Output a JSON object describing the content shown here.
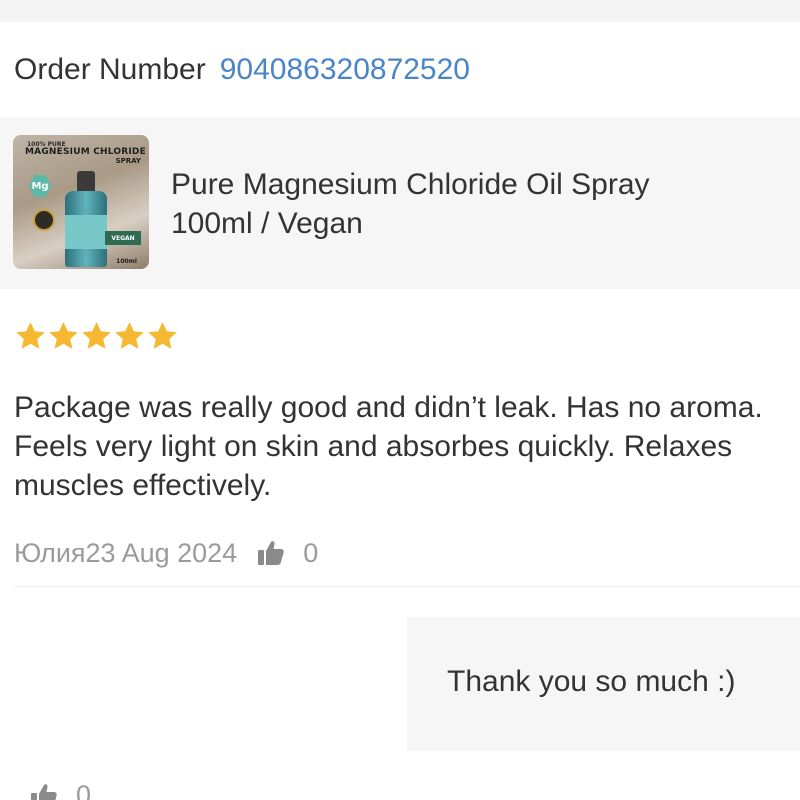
{
  "order": {
    "label": "Order Number",
    "number": "904086320872520"
  },
  "product": {
    "title_line1": "Pure Magnesium Chloride Oil Spray",
    "title_line2": "100ml / Vegan",
    "image": {
      "top_text": "100% PURE",
      "name": "MAGNESIUM CHLORIDE",
      "form": "SPRAY",
      "symbol": "Mg",
      "badge": "VEGAN",
      "volume": "100ml"
    }
  },
  "review": {
    "rating": 5,
    "rating_max": 5,
    "star_color": "#f6b830",
    "text": "Package was really good and didn’t leak. Has no aroma. Feels very light on skin and absorbes quickly. Relaxes muscles effectively.",
    "author": "Юлия",
    "date": "23 Aug 2024",
    "likes": "0",
    "like_icon": "thumbs-up-icon"
  },
  "reply": {
    "text": "Thank you so much :)",
    "likes": "0",
    "like_icon": "thumbs-up-icon"
  },
  "colors": {
    "link": "#4a86c5",
    "muted": "#9b9b9b",
    "card_bg": "#f6f6f6"
  }
}
